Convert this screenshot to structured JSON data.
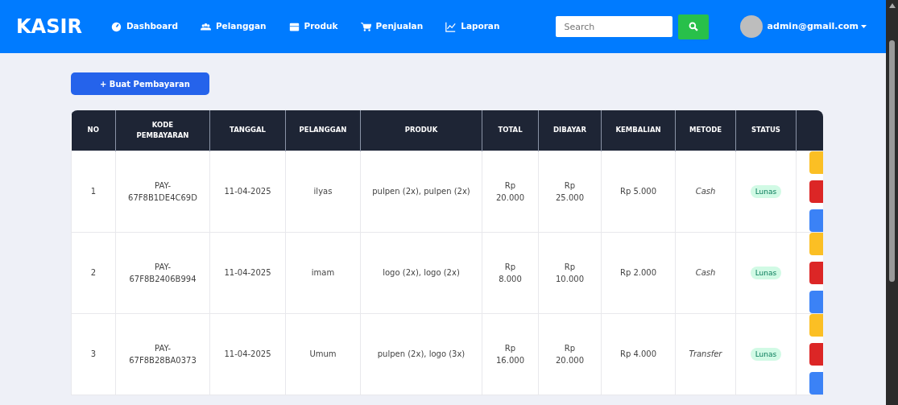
{
  "navbar": {
    "brand": "KASIR",
    "items": [
      {
        "label": "Dashboard"
      },
      {
        "label": "Pelanggan"
      },
      {
        "label": "Produk"
      },
      {
        "label": "Penjualan"
      },
      {
        "label": "Laporan"
      }
    ],
    "search": {
      "placeholder": "Search"
    },
    "user": {
      "email": "admin@gmail.com"
    }
  },
  "add_button": "+ Buat Pembayaran",
  "table": {
    "columns": [
      "NO",
      "KODE PEMBAYARAN",
      "TANGGAL",
      "PELANGGAN",
      "PRODUK",
      "TOTAL",
      "DIBAYAR",
      "KEMBALIAN",
      "METODE",
      "STATUS"
    ],
    "rows": [
      {
        "no": "1",
        "kode": "PAY-67F8B1DE4C69D",
        "tanggal": "11-04-2025",
        "pelanggan": "ilyas",
        "produk": "pulpen (2x), pulpen (2x)",
        "total": "Rp 20.000",
        "dibayar": "Rp 25.000",
        "kembalian": "Rp 5.000",
        "metode": "Cash",
        "status": "Lunas",
        "actions": [
          {
            "color": "#fbbf24"
          },
          {
            "color": "#dc2626"
          },
          {
            "color": "#3b82f6"
          }
        ]
      },
      {
        "no": "2",
        "kode": "PAY-67F8B2406B994",
        "tanggal": "11-04-2025",
        "pelanggan": "imam",
        "produk": "logo (2x), logo (2x)",
        "total": "Rp 8.000",
        "dibayar": "Rp 10.000",
        "kembalian": "Rp 2.000",
        "metode": "Cash",
        "status": "Lunas",
        "actions": [
          {
            "color": "#fbbf24"
          },
          {
            "color": "#dc2626"
          },
          {
            "color": "#3b82f6"
          }
        ]
      },
      {
        "no": "3",
        "kode": "PAY-67F8B28BA0373",
        "tanggal": "11-04-2025",
        "pelanggan": "Umum",
        "produk": "pulpen (2x), logo (3x)",
        "total": "Rp 16.000",
        "dibayar": "Rp 20.000",
        "kembalian": "Rp 4.000",
        "metode": "Transfer",
        "status": "Lunas",
        "actions": [
          {
            "color": "#fbbf24"
          },
          {
            "color": "#dc2626"
          },
          {
            "color": "#3b82f6"
          }
        ]
      }
    ]
  }
}
